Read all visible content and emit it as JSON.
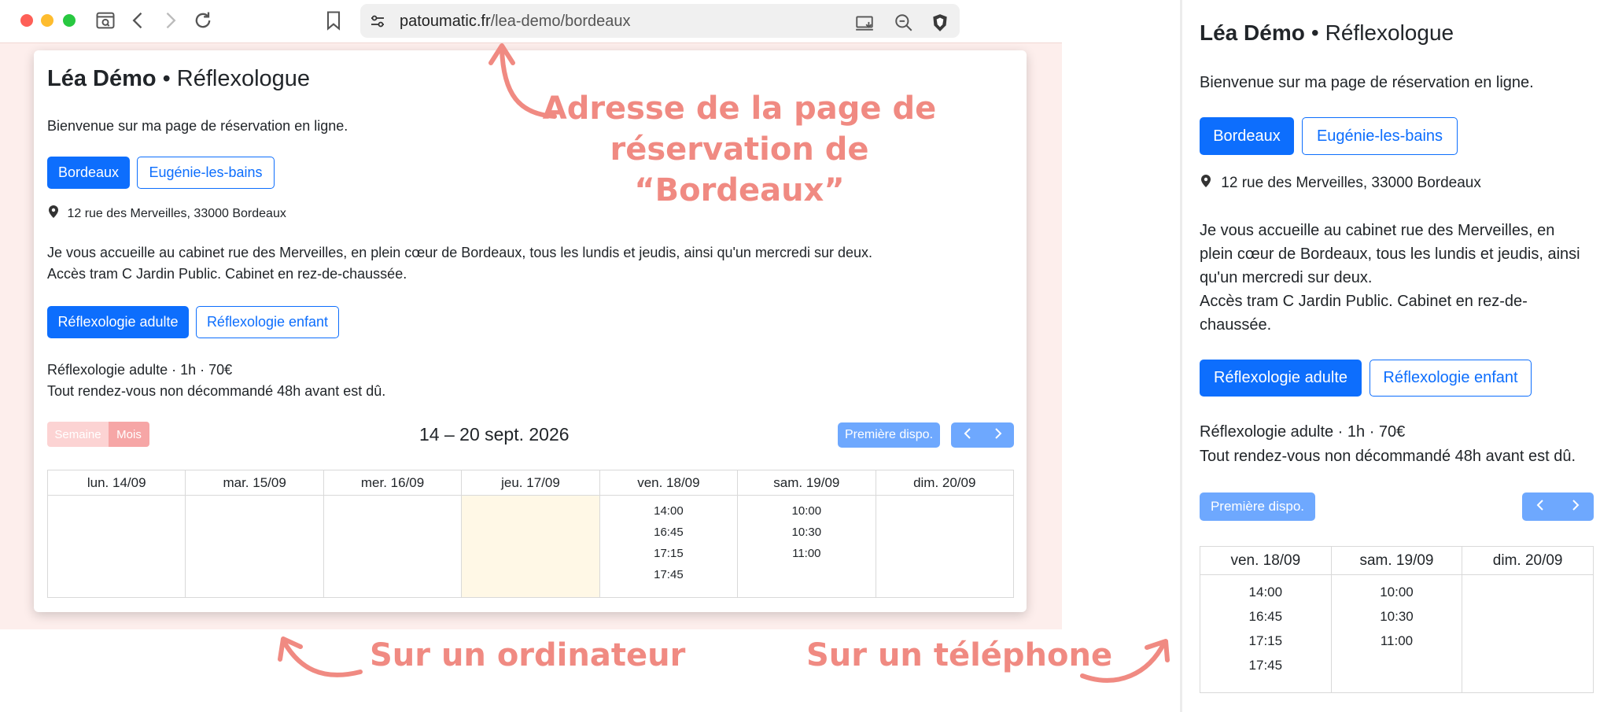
{
  "browser": {
    "url_host": "patoumatic.fr",
    "url_path": "/lea-demo/bordeaux",
    "icons": [
      "sidebar-icon",
      "back-icon",
      "forward-icon",
      "reload-icon",
      "bookmark-icon",
      "site-settings-icon",
      "install-app-icon",
      "zoom-out-icon",
      "brave-shields-icon"
    ]
  },
  "page": {
    "name": "Léa Démo",
    "separator": "•",
    "profession": "Réflexologue",
    "welcome": "Bienvenue sur ma page de réservation en ligne.",
    "locations": [
      {
        "label": "Bordeaux",
        "selected": true
      },
      {
        "label": "Eugénie-les-bains",
        "selected": false
      }
    ],
    "address": "12 rue des Merveilles, 33000 Bordeaux",
    "description_line1": "Je vous accueille au cabinet rue des Merveilles, en plein cœur de Bordeaux, tous les lundis et jeudis, ainsi qu'un mercredi sur deux.",
    "description_line2": "Accès tram C Jardin Public. Cabinet en rez-de-chaussée.",
    "mobile_description": [
      "Je vous accueille au cabinet rue des Merveilles, en",
      "plein cœur de Bordeaux, tous les lundis et jeudis, ainsi",
      "qu'un mercredi sur deux.",
      "Accès tram C Jardin Public. Cabinet en rez-de-",
      "chaussée."
    ],
    "services": [
      {
        "label": "Réflexologie adulte",
        "selected": true
      },
      {
        "label": "Réflexologie enfant",
        "selected": false
      }
    ],
    "service_info": "Réflexologie adulte · 1h · 70€",
    "cancellation_policy": "Tout rendez-vous non décommandé 48h avant est dû.",
    "view_toggle": {
      "week": "Semaine",
      "month": "Mois"
    },
    "week_range": "14 – 20 sept. 2026",
    "first_available": "Première dispo.",
    "prev_icon": "chevron-left-icon",
    "next_icon": "chevron-right-icon",
    "calendar": [
      {
        "day": "lun. 14/09",
        "slots": [],
        "highlight": false
      },
      {
        "day": "mar. 15/09",
        "slots": [],
        "highlight": false
      },
      {
        "day": "mer. 16/09",
        "slots": [],
        "highlight": false
      },
      {
        "day": "jeu. 17/09",
        "slots": [],
        "highlight": true
      },
      {
        "day": "ven. 18/09",
        "slots": [
          "14:00",
          "16:45",
          "17:15",
          "17:45"
        ],
        "highlight": false
      },
      {
        "day": "sam. 19/09",
        "slots": [
          "10:00",
          "10:30",
          "11:00"
        ],
        "highlight": false
      },
      {
        "day": "dim. 20/09",
        "slots": [],
        "highlight": false
      }
    ]
  },
  "annotations": {
    "address_line1": "Adresse de la page de",
    "address_line2": "réservation de “Bordeaux”",
    "desktop": "Sur un ordinateur",
    "phone": "Sur un téléphone"
  },
  "colors": {
    "primary": "#0d6efd",
    "primary_faded": "#6ea8fe",
    "annotation": "#f08a82",
    "toggle_faded": "#f8b7b7",
    "today_highlight": "#fff8e6",
    "page_bg": "#fdeeec"
  }
}
